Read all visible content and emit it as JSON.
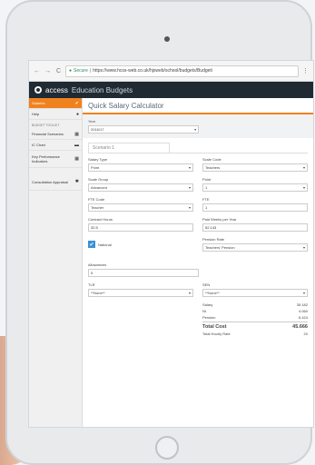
{
  "browser": {
    "secure_label": "Secure",
    "url": "https://www.hcss-web.co.uk/hjsweb/school/budgets/Budget/"
  },
  "app": {
    "brand_light": "access",
    "brand_bold": "Education Budgets"
  },
  "sidebar": {
    "items": [
      {
        "label": "Salaries"
      },
      {
        "label": "Help"
      }
    ],
    "section_label": "BUDGET TOOLKIT",
    "tools": [
      {
        "label": "Financial Scenarios"
      },
      {
        "label": "IC Chart"
      },
      {
        "label": "Key Performance Indicators"
      },
      {
        "label": "Consultation Appraisal"
      }
    ]
  },
  "page": {
    "title": "Quick Salary Calculator",
    "year_label": "Year",
    "year_value": "2016/17",
    "scenario_label": "Scenario 1"
  },
  "form": {
    "salary_type_label": "Salary Type",
    "salary_type_value": "Point",
    "scale_code_label": "Scale Code",
    "scale_code_value": "Teachers",
    "scale_group_label": "Scale Group",
    "scale_group_value": "Advanced",
    "point_label": "Point",
    "point_value": "1",
    "fte_code_label": "FTE Code",
    "fte_code_value": "Teacher",
    "fte_label": "FTE",
    "fte_value": "1",
    "contract_hours_label": "Contract Hours",
    "contract_hours_value": "32.5",
    "paid_weeks_label": "Paid Weeks per Year",
    "paid_weeks_value": "52.143",
    "ni_label": "National",
    "pension_label": "Pension Rate",
    "pension_value": "Teachers' Pension",
    "allowances_label": "Allowances",
    "allowances_value": "0",
    "tlr_label": "TLR",
    "tlr_value": "**None**",
    "sen_label": "SEN",
    "sen_value": "**None**"
  },
  "totals": {
    "salary_label": "Salary",
    "salary_value": "35.182",
    "ni_label": "NI",
    "ni_value": "4.060",
    "pension_label": "Pension",
    "pension_value": "6.424",
    "total_label": "Total Cost",
    "total_value": "45.666",
    "hourly_label": "Total Hourly Rate",
    "hourly_value": "20"
  }
}
